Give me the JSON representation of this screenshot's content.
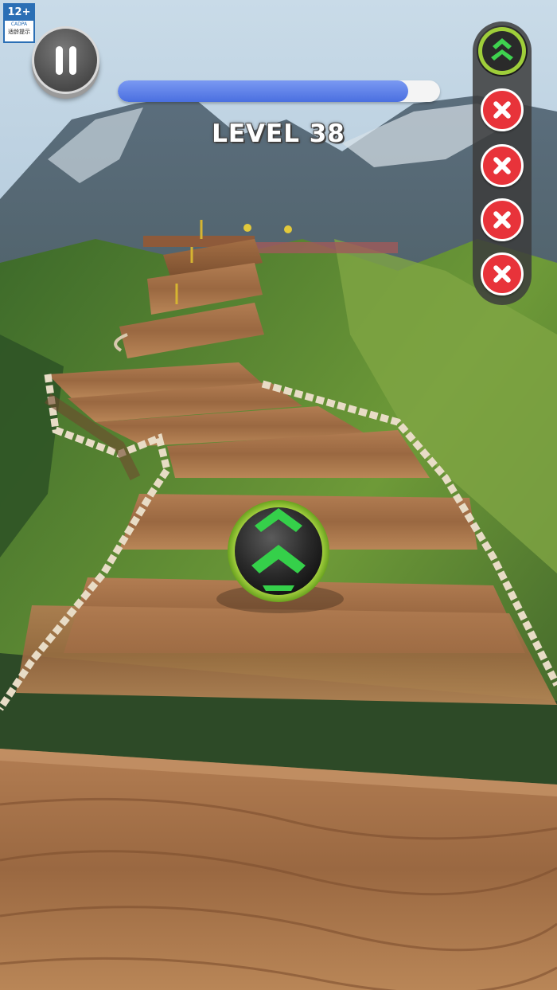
{
  "age_rating": {
    "label": "12+",
    "org": "CADPA",
    "note": "适龄提示"
  },
  "hud": {
    "level_title": "LEVEL 38",
    "progress_fraction": 0.9,
    "accent_color": "#4a6fe0"
  },
  "lives": {
    "current_ball_icon": "green-chevron-ball-icon",
    "slots": [
      {
        "state": "lost",
        "icon": "red-x-icon"
      },
      {
        "state": "lost",
        "icon": "red-x-icon"
      },
      {
        "state": "lost",
        "icon": "red-x-icon"
      },
      {
        "state": "lost",
        "icon": "red-x-icon"
      }
    ]
  }
}
